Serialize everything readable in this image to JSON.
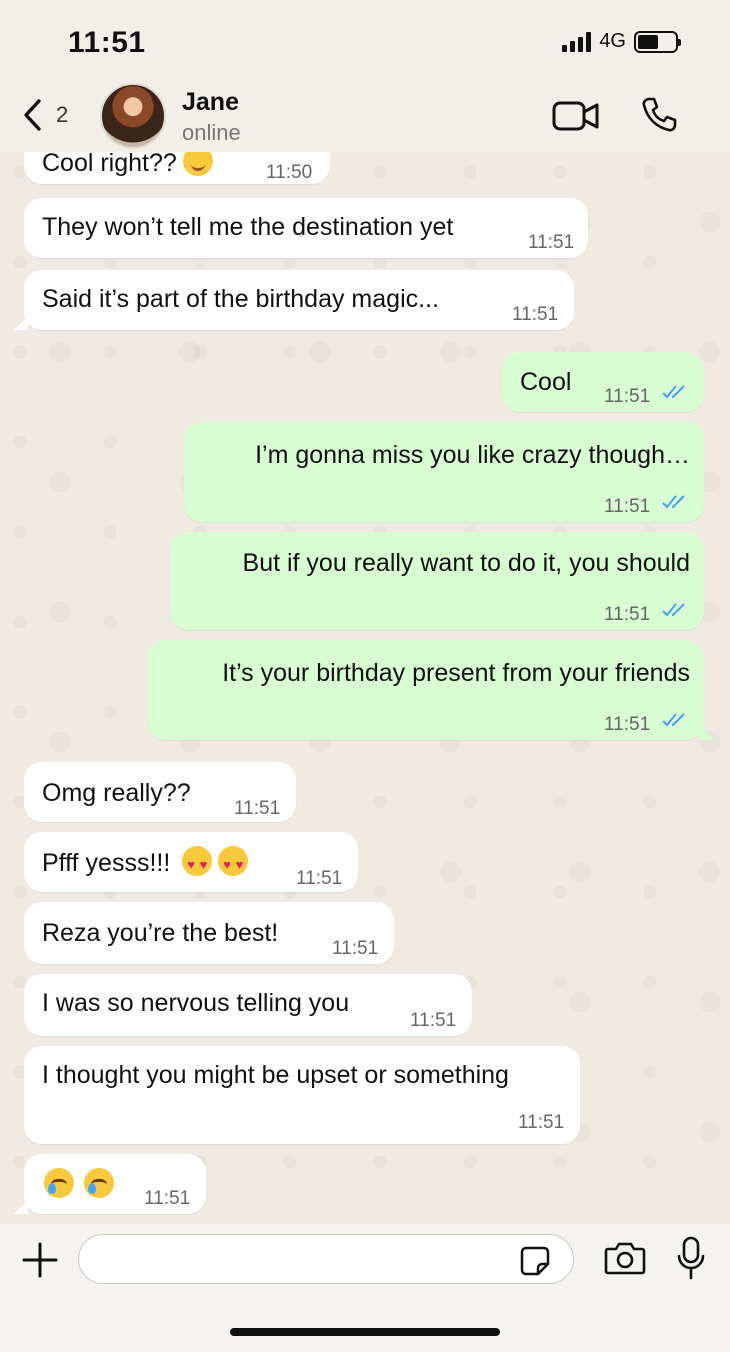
{
  "status_bar": {
    "time": "11:51",
    "network": "4G"
  },
  "header": {
    "back_count": "2",
    "contact_name": "Jane",
    "contact_status": "online"
  },
  "messages": [
    {
      "dir": "in",
      "text": "Cool right??",
      "emoji": [
        "smiling-face"
      ],
      "time": "11:50"
    },
    {
      "dir": "in",
      "text": "They won’t tell me the destination yet",
      "time": "11:51"
    },
    {
      "dir": "in",
      "text": "Said it’s part of the birthday magic...",
      "time": "11:51"
    },
    {
      "dir": "out",
      "text": "Cool",
      "time": "11:51",
      "read": true
    },
    {
      "dir": "out",
      "text": "I’m gonna miss you like crazy though…",
      "time": "11:51",
      "read": true
    },
    {
      "dir": "out",
      "text": "But if you really want to do it, you should",
      "time": "11:51",
      "read": true
    },
    {
      "dir": "out",
      "text": "It’s your birthday present from your friends",
      "time": "11:51",
      "read": true
    },
    {
      "dir": "in",
      "text": "Omg really??",
      "time": "11:51"
    },
    {
      "dir": "in",
      "text": "Pfff yesss!!!",
      "emoji": [
        "heart-eyes",
        "heart-eyes"
      ],
      "time": "11:51"
    },
    {
      "dir": "in",
      "text": "Reza you’re the best!",
      "time": "11:51"
    },
    {
      "dir": "in",
      "text": "I was so nervous telling you",
      "time": "11:51"
    },
    {
      "dir": "in",
      "text": "I thought you might be upset or something",
      "time": "11:51"
    },
    {
      "dir": "in",
      "text": "",
      "emoji": [
        "face-holding-back-tears",
        "face-holding-back-tears"
      ],
      "time": "11:51"
    }
  ],
  "composer": {
    "input_value": "",
    "placeholder": ""
  },
  "colors": {
    "incoming": "#ffffff",
    "outgoing": "#d9fdd3",
    "read_ticks": "#4a9ff5"
  }
}
